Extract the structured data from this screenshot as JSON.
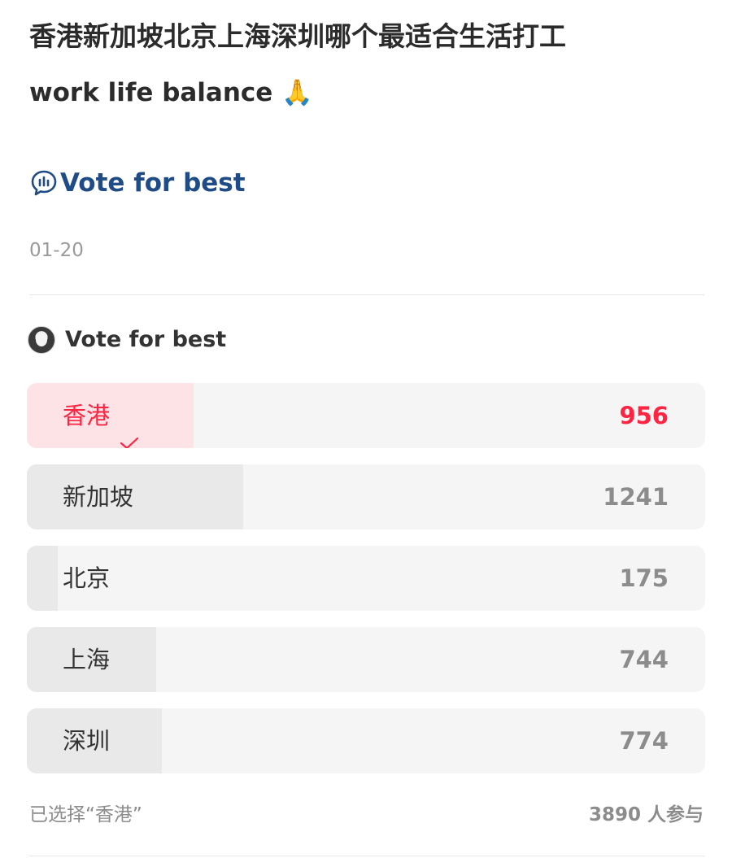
{
  "post": {
    "title": "香港新加坡北京上海深圳哪个最适合生活打工",
    "subtitle": "work life balance 🙏",
    "topic_link": "Vote for best",
    "topic_icon": "poll-bubble-icon",
    "date": "01-20"
  },
  "poll": {
    "title": "Vote for best",
    "accent_color": "#ff2442",
    "options": [
      {
        "label": "香港",
        "count": "956",
        "selected": true,
        "share": 0.246
      },
      {
        "label": "新加坡",
        "count": "1241",
        "selected": false,
        "share": 0.319
      },
      {
        "label": "北京",
        "count": "175",
        "selected": false,
        "share": 0.045
      },
      {
        "label": "上海",
        "count": "744",
        "selected": false,
        "share": 0.191
      },
      {
        "label": "深圳",
        "count": "774",
        "selected": false,
        "share": 0.199
      }
    ],
    "selected_text": "已选择“香港”",
    "participants": "3890 人参与"
  }
}
